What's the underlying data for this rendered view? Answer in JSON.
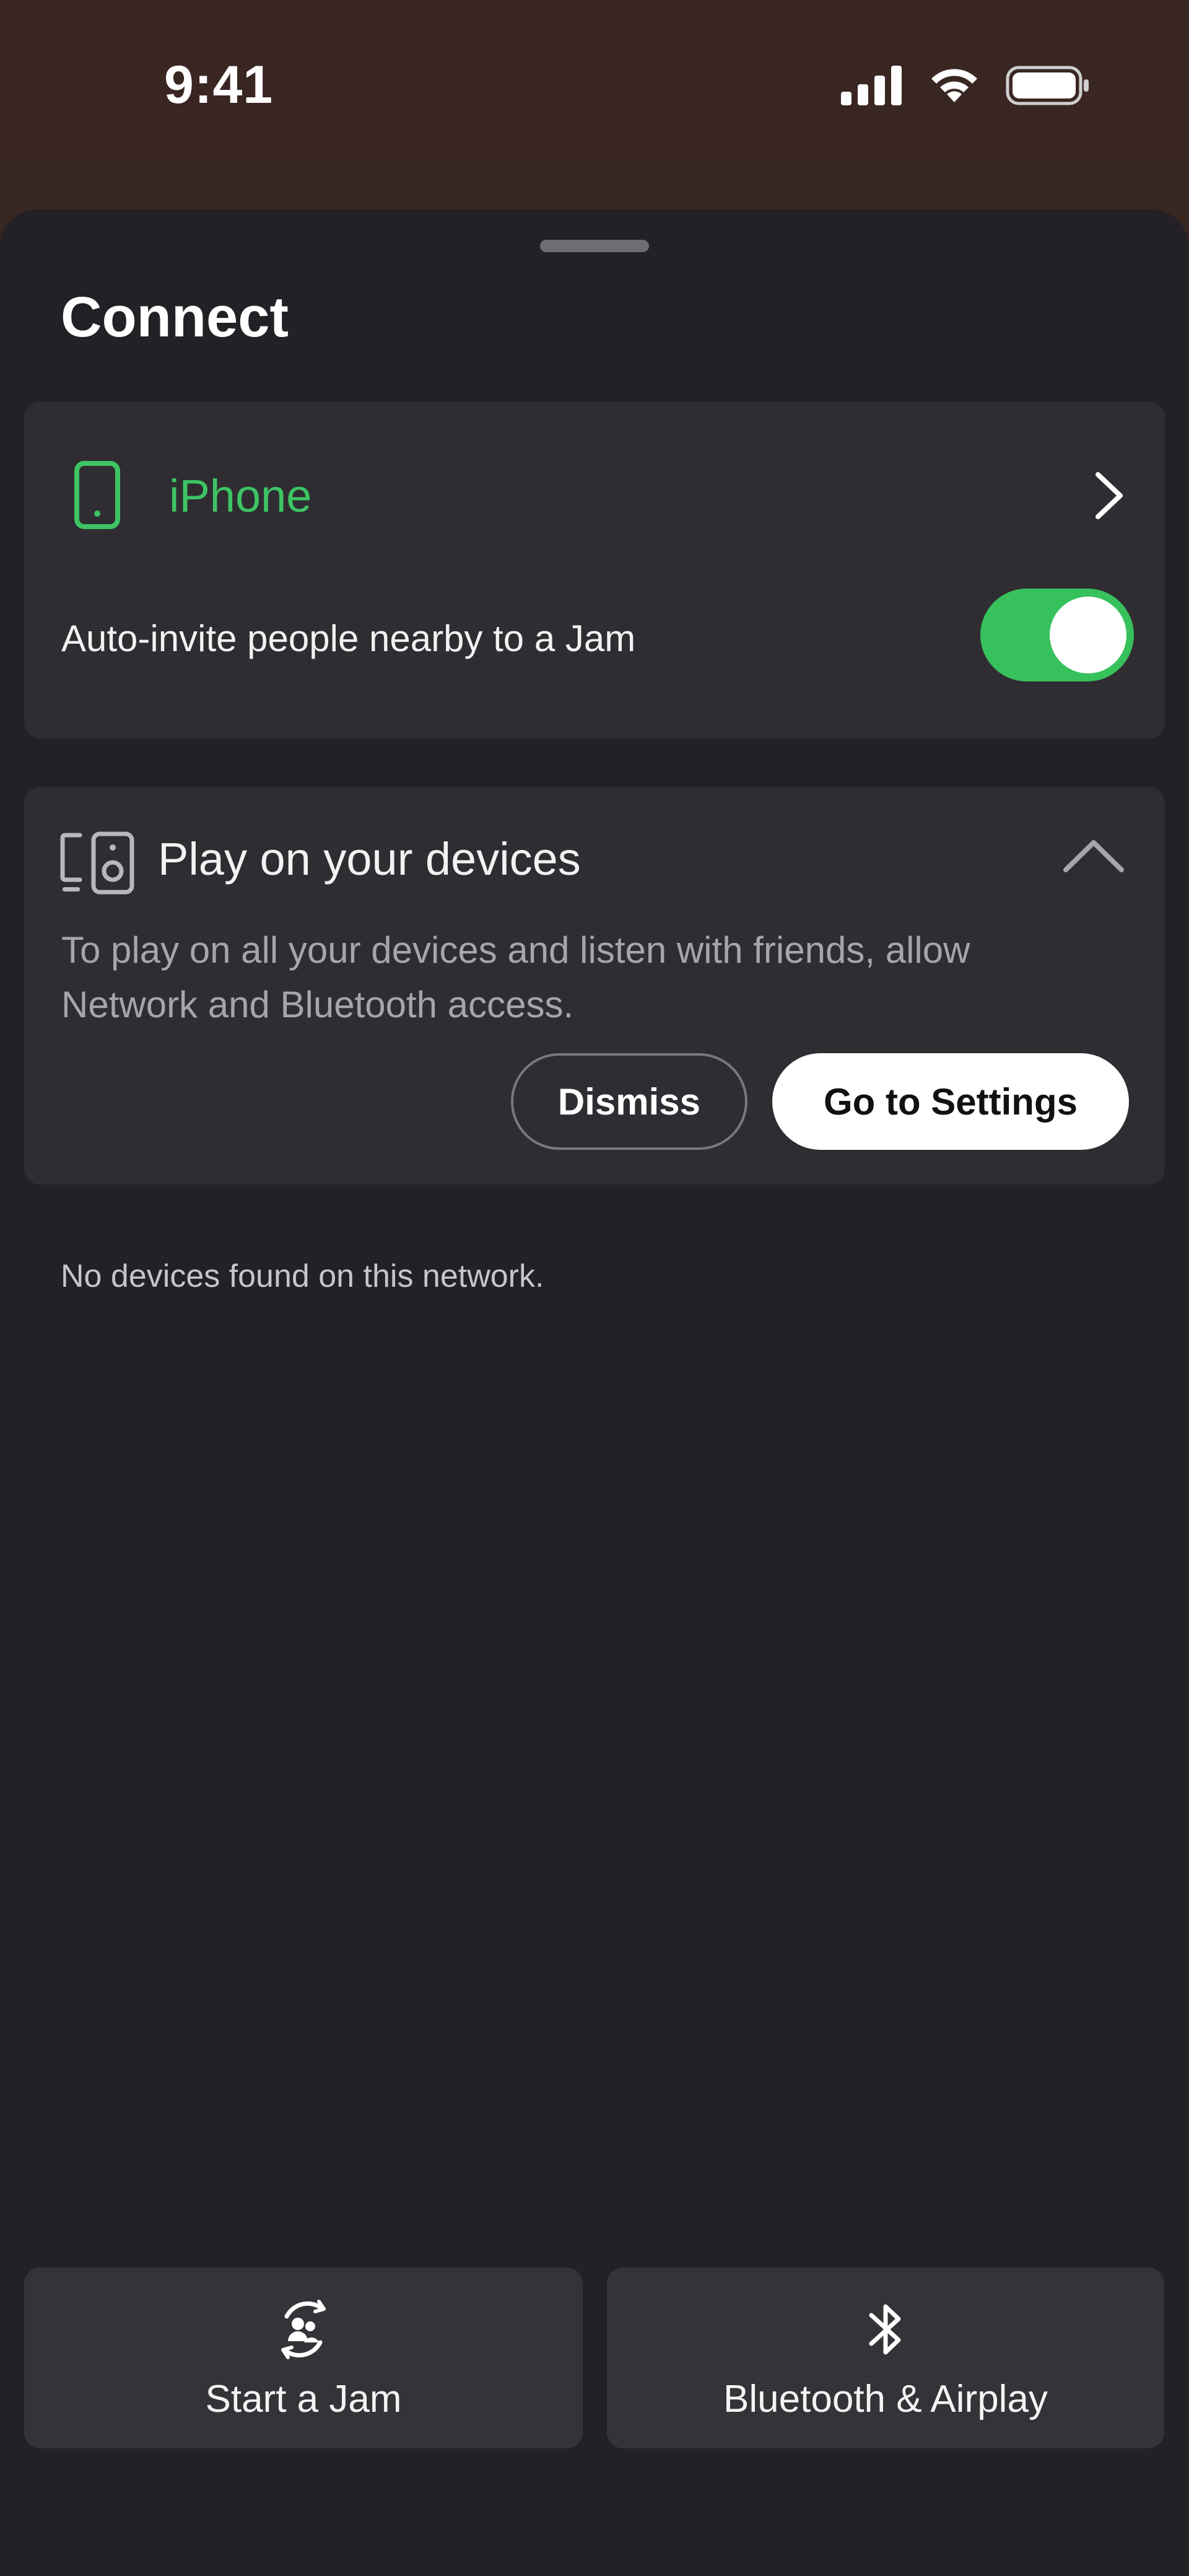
{
  "status_bar": {
    "time": "9:41"
  },
  "sheet": {
    "title": "Connect"
  },
  "current_device": {
    "name": "iPhone",
    "icon": "phone-icon",
    "accent_color": "#3ec463"
  },
  "auto_invite": {
    "label": "Auto-invite people nearby to a Jam",
    "enabled": true
  },
  "permission_card": {
    "icon": "devices-speaker-icon",
    "title": "Play on your devices",
    "body": "To play on all your devices and listen with friends, allow Network and Bluetooth access.",
    "dismiss_label": "Dismiss",
    "settings_label": "Go to Settings"
  },
  "devices": {
    "empty_message": "No devices found on this network."
  },
  "bottom_actions": {
    "jam": {
      "label": "Start a Jam",
      "icon": "jam-icon"
    },
    "bluetooth": {
      "label": "Bluetooth & Airplay",
      "icon": "bluetooth-icon"
    }
  }
}
